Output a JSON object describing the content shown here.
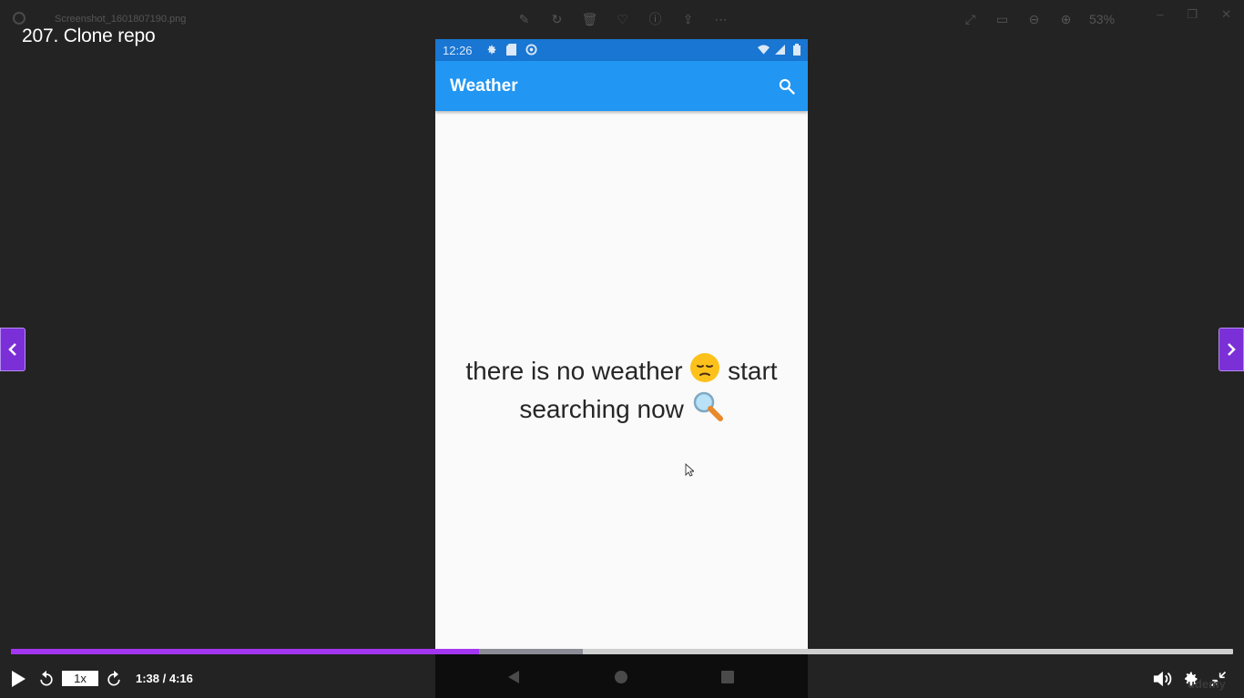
{
  "viewer": {
    "filename": "Screenshot_1601807190.png",
    "zoom": "53%"
  },
  "lecture": {
    "title": "207. Clone repo"
  },
  "phone": {
    "status_time": "12:26",
    "app_title": "Weather",
    "empty_message_line1": "there is no weather",
    "empty_emoji_1": "😔",
    "empty_message_word": "start",
    "empty_message_line2": "searching now",
    "empty_emoji_2": "🔍"
  },
  "player": {
    "speed": "1x",
    "time": "1:38 / 4:16",
    "progress_fraction": 0.3828,
    "buffered_fraction": 0.468,
    "watermark": "udemy"
  },
  "colors": {
    "accent": "#a435f0",
    "appbar": "#2196f3",
    "statusbar": "#1976d2",
    "background": "#232323"
  }
}
